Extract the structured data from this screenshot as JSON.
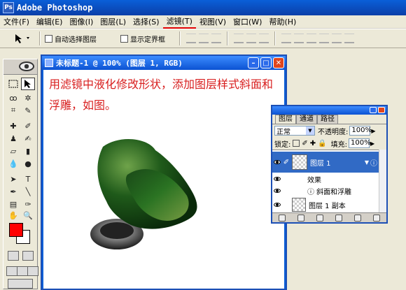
{
  "app": {
    "title": "Adobe Photoshop",
    "icon_text": "Ps"
  },
  "menu": [
    {
      "label": "文件(F)"
    },
    {
      "label": "编辑(E)"
    },
    {
      "label": "图像(I)"
    },
    {
      "label": "图层(L)"
    },
    {
      "label": "选择(S)"
    },
    {
      "label": "滤镜(T)"
    },
    {
      "label": "视图(V)"
    },
    {
      "label": "窗口(W)"
    },
    {
      "label": "帮助(H)"
    }
  ],
  "active_menu": "滤镜(T)",
  "options": {
    "auto_select_layer": "自动选择图层",
    "show_bounding_box": "显示定界框"
  },
  "document": {
    "title": "未标题-1 @ 100% (图层 1, RGB)",
    "caption": "用滤镜中液化修改形状，添加图层样式斜面和浮雕，如图。"
  },
  "colors": {
    "foreground": "#ff0000",
    "background": "#ffffff",
    "caption": "#d81e1e"
  },
  "layers_panel": {
    "tabs": [
      "图层",
      "通道",
      "路径"
    ],
    "blend_mode": "正常",
    "opacity_label": "不透明度:",
    "opacity_value": "100%",
    "lock_label": "锁定:",
    "fill_label": "填充:",
    "fill_value": "100%",
    "layers": [
      {
        "name": "图层 1",
        "selected": true
      },
      {
        "name": "效果"
      },
      {
        "name": "斜面和浮雕"
      },
      {
        "name": "图层 1 副本"
      }
    ]
  }
}
